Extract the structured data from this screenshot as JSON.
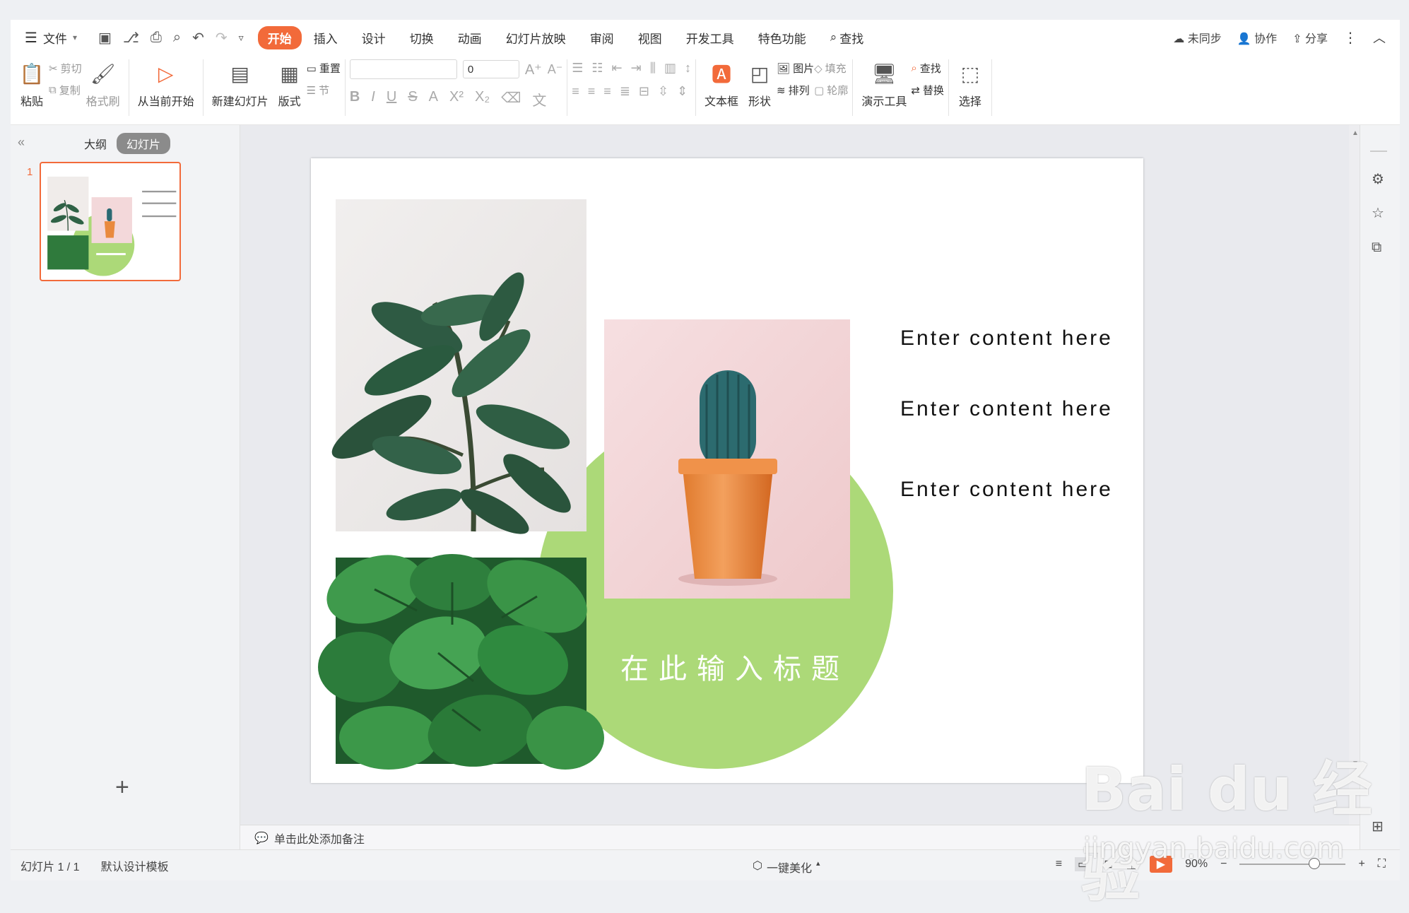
{
  "menu": {
    "file_label": "文件",
    "tabs": [
      "开始",
      "插入",
      "设计",
      "切换",
      "动画",
      "幻灯片放映",
      "审阅",
      "视图",
      "开发工具",
      "特色功能"
    ],
    "search_label": "查找",
    "right": {
      "sync": "未同步",
      "collab": "协作",
      "share": "分享"
    }
  },
  "ribbon": {
    "paste": "粘贴",
    "cut": "剪切",
    "copy": "复制",
    "format_painter": "格式刷",
    "play_from_current": "从当前开始",
    "new_slide": "新建幻灯片",
    "layout": "版式",
    "reset": "重置",
    "section": "节",
    "font_size": "0",
    "textbox": "文本框",
    "shape": "形状",
    "picture": "图片",
    "fill": "填充",
    "arrange": "排列",
    "outline": "轮廓",
    "present_tools": "演示工具",
    "find": "查找",
    "replace": "替换",
    "select": "选择"
  },
  "left_panel": {
    "tab_outline": "大纲",
    "tab_slides": "幻灯片",
    "slide_number": "1"
  },
  "slide": {
    "contents": [
      "Enter content here",
      "Enter content here",
      "Enter content here"
    ],
    "title": "在此输入标题",
    "accent_color": "#acd978"
  },
  "notes": {
    "placeholder": "单击此处添加备注"
  },
  "status": {
    "slide_count": "幻灯片 1 / 1",
    "template": "默认设计模板",
    "beautify": "一键美化",
    "zoom": "90%"
  },
  "watermark": {
    "brand": "Bai du 经验",
    "url": "jingyan.baidu.com"
  }
}
